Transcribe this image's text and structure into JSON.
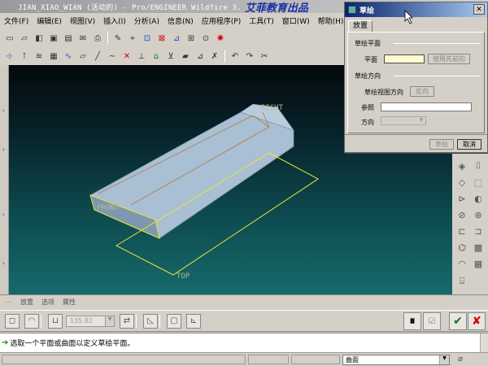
{
  "window": {
    "title": "JIAN_XIAO_WIAN (活动的) - Pro/ENGINEER Wildfire 3.",
    "watermark": "艾菲教育出品"
  },
  "menu": [
    {
      "label": "文件(F)"
    },
    {
      "label": "编辑(E)"
    },
    {
      "label": "视图(V)"
    },
    {
      "label": "插入(I)"
    },
    {
      "label": "分析(A)"
    },
    {
      "label": "信息(N)"
    },
    {
      "label": "应用程序(P)"
    },
    {
      "label": "工具(T)"
    },
    {
      "label": "窗口(W)"
    },
    {
      "label": "帮助(H)"
    }
  ],
  "viewport": {
    "datum_labels": {
      "right": "RIGHT",
      "front": "FRONT",
      "top": "TOP"
    }
  },
  "dashboard": {
    "tabs": [
      {
        "label": "放置"
      },
      {
        "label": "选项"
      },
      {
        "label": "属性"
      }
    ],
    "depth_value": "135.82"
  },
  "status": {
    "message": "选取一个平面或曲面以定义草绘平面。"
  },
  "filter": {
    "value": "曲面"
  },
  "dialog": {
    "title": "草绘",
    "tab": "放置",
    "plane_group": "草绘平面",
    "plane_label": "平面",
    "use_previous": "使用先前的",
    "orientation_group": "草绘方向",
    "view_dir_label": "草绘视图方向",
    "flip": "反向",
    "reference_label": "参照",
    "direction_label": "方向",
    "sketch_button": "草绘",
    "cancel_button": "取消"
  },
  "colors": {
    "viewport_top": "#04090c",
    "viewport_bottom": "#166a6a",
    "datum_plane": "#e8e831",
    "datum_label": "#b9b98a",
    "part_fill": "#9fb8cf",
    "dialog_title": "#0a246a"
  }
}
